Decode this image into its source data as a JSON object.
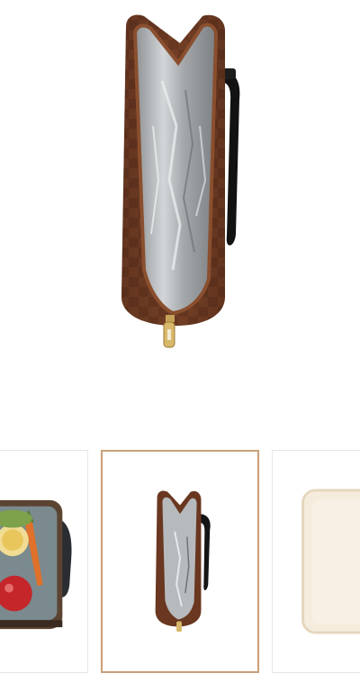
{
  "gallery": {
    "main_image": {
      "icon": "insulated-cooler-bag-open-product-photo"
    },
    "thumbnails": [
      {
        "icon": "lunch-bag-with-food-thumbnail",
        "selected": false
      },
      {
        "icon": "open-insulated-bag-thumbnail",
        "selected": true
      },
      {
        "icon": "beige-pad-thumbnail",
        "selected": false
      }
    ],
    "colors": {
      "accent_border": "#c9a07a",
      "bag_brown": "#6b3b25",
      "lining_silver": "#b9bcbe"
    }
  }
}
